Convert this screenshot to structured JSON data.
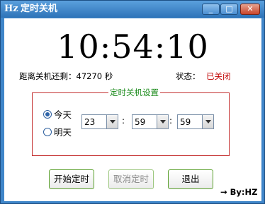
{
  "window": {
    "title": "定时关机",
    "app_icon": "Hz",
    "buttons": {
      "minimize": "_",
      "maximize": "□",
      "close": "✕"
    }
  },
  "clock": {
    "time": "10:54:10"
  },
  "countdown": {
    "text": "距离关机还剩：47270 秒"
  },
  "status": {
    "label": "状态：",
    "value": "已关闭",
    "value_color": "#c00000"
  },
  "settings": {
    "title": "定时关机设置",
    "title_color": "#1a8a1a",
    "day_options": [
      {
        "label": "今天",
        "selected": true
      },
      {
        "label": "明天",
        "selected": false
      }
    ],
    "hour": "23",
    "minute": "59",
    "second": "59",
    "separator": ":"
  },
  "actions": {
    "start": "开始定时",
    "cancel": "取消定时",
    "exit": "退出"
  },
  "byline": "→ By:HZ"
}
